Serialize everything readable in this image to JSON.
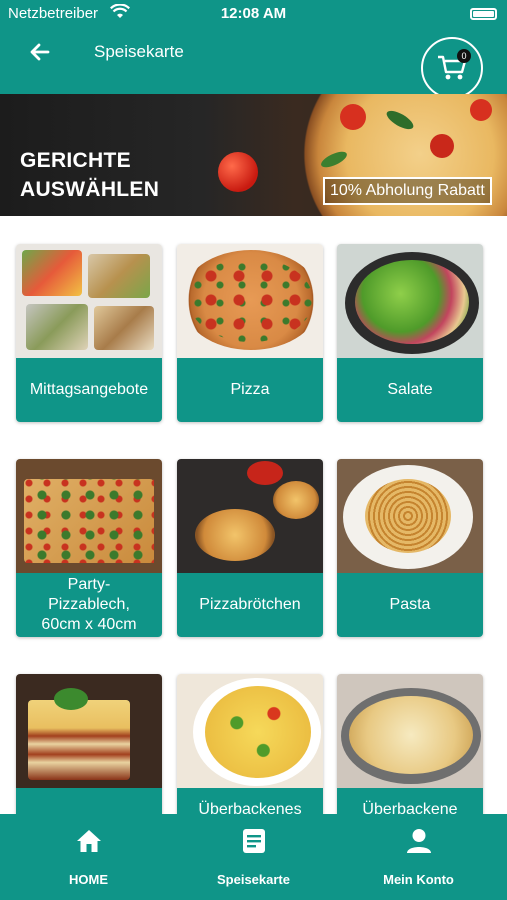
{
  "status_bar": {
    "carrier": "Netzbetreiber",
    "time": "12:08 AM"
  },
  "header": {
    "title": "Speisekarte",
    "cart_count": "0"
  },
  "banner": {
    "heading_line1": "GERICHTE",
    "heading_line2": "AUSWÄHLEN",
    "promo": "10% Abholung Rabatt"
  },
  "categories": [
    {
      "label": "Mittagsangebote",
      "image": "lunch-boxes"
    },
    {
      "label": "Pizza",
      "image": "pizza"
    },
    {
      "label": "Salate",
      "image": "salad"
    },
    {
      "label": "Party-Pizzablech, 60cm x 40cm",
      "image": "party-pizza"
    },
    {
      "label": "Pizzabrötchen",
      "image": "pizza-rolls"
    },
    {
      "label": "Pasta",
      "image": "pasta"
    },
    {
      "label": "",
      "image": "lasagne"
    },
    {
      "label": "Überbackenes",
      "image": "casserole"
    },
    {
      "label": "Überbackene",
      "image": "gratin"
    }
  ],
  "bottom_nav": {
    "items": [
      {
        "label": "HOME",
        "icon": "home-icon"
      },
      {
        "label": "Speisekarte",
        "icon": "menu-icon"
      },
      {
        "label": "Mein Konto",
        "icon": "user-icon"
      }
    ]
  },
  "colors": {
    "primary": "#0f9588"
  }
}
